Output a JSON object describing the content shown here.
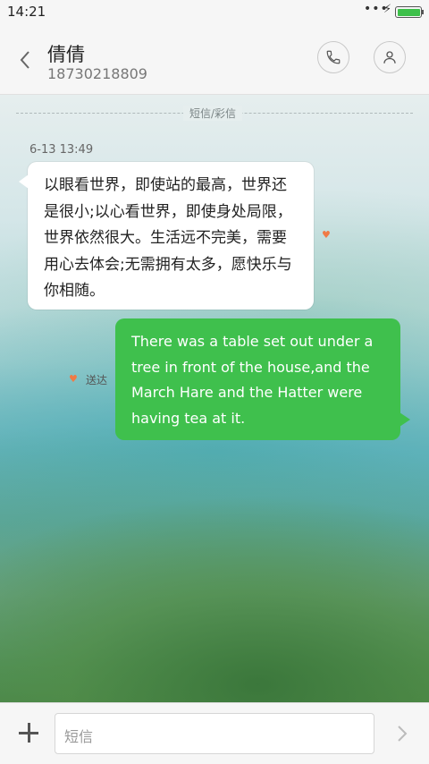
{
  "status_bar": {
    "time": "14:21",
    "dots": "•••",
    "bolt": "⚡",
    "battery_level": 1.0
  },
  "contact": {
    "name": "倩倩",
    "number": "18730218809"
  },
  "icons": {
    "back": "chevron-left-icon",
    "call": "phone-icon",
    "profile": "person-icon",
    "heart": "heart-icon",
    "attach": "plus-icon",
    "send": "chevron-right-icon"
  },
  "thread": {
    "channel_label": "短信/彩信"
  },
  "messages": [
    {
      "direction": "incoming",
      "timestamp": "6-13 13:49",
      "lines": [
        "以眼看世界，即使站的最高，世界还",
        "是很小;以心看世界，即使身处局限，",
        "世界依然很大。生活远不完美，需要",
        "用心去体会;无需拥有太多，愿快乐与",
        "你相随。"
      ]
    },
    {
      "direction": "outgoing",
      "status": "送达",
      "lines": [
        "There was a table set out under a",
        "tree in front of the house,and the",
        "March Hare and the Hatter were",
        "having tea at it."
      ]
    }
  ],
  "composer": {
    "placeholder": "短信"
  },
  "colors": {
    "outgoing_bubble": "#3fc04d",
    "incoming_bubble": "#ffffff",
    "heart": "#f07a45",
    "battery": "#3dc04a"
  }
}
